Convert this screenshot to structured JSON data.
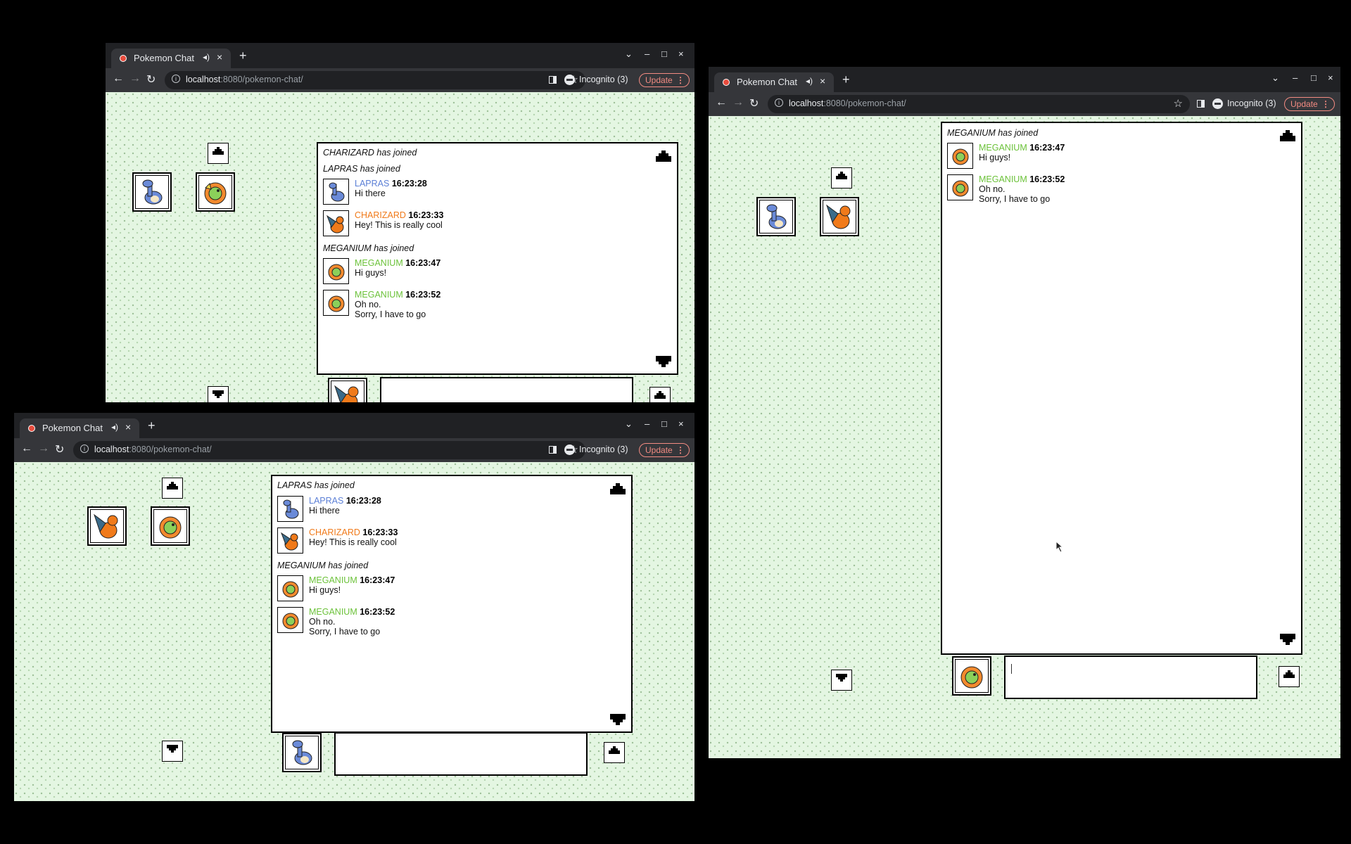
{
  "browser": {
    "tab_title": "Pokemon Chat",
    "url_host": "localhost",
    "url_rest": ":8080/pokemon-chat/",
    "incognito_label": "Incognito (3)",
    "update_label": "Update"
  },
  "colors": {
    "laprasName": "#5b7fd6",
    "charizardName": "#f07a1a",
    "meganiumName": "#6cc23a"
  },
  "icons": {
    "scroll_up": "up-arrow-icon",
    "scroll_down": "down-arrow-icon"
  },
  "win1": {
    "log": [
      {
        "joined": "CHARIZARD has joined"
      },
      {
        "joined": "LAPRAS has joined"
      },
      {
        "name": "LAPRAS",
        "time": "16:23:28",
        "lines": [
          "Hi there"
        ]
      },
      {
        "name": "CHARIZARD",
        "time": "16:23:33",
        "lines": [
          "Hey! This is really cool"
        ]
      },
      {
        "joined": "MEGANIUM has joined"
      },
      {
        "name": "MEGANIUM",
        "time": "16:23:47",
        "lines": [
          "Hi guys!"
        ]
      },
      {
        "name": "MEGANIUM",
        "time": "16:23:52",
        "lines": [
          "Oh no.",
          "Sorry, I have to go"
        ]
      }
    ]
  },
  "win2": {
    "log": [
      {
        "joined": "LAPRAS has joined"
      },
      {
        "name": "LAPRAS",
        "time": "16:23:28",
        "lines": [
          "Hi there"
        ]
      },
      {
        "name": "CHARIZARD",
        "time": "16:23:33",
        "lines": [
          "Hey! This is really cool"
        ]
      },
      {
        "joined": "MEGANIUM has joined"
      },
      {
        "name": "MEGANIUM",
        "time": "16:23:47",
        "lines": [
          "Hi guys!"
        ]
      },
      {
        "name": "MEGANIUM",
        "time": "16:23:52",
        "lines": [
          "Oh no.",
          "Sorry, I have to go"
        ]
      }
    ]
  },
  "win3": {
    "log": [
      {
        "joined": "MEGANIUM has joined"
      },
      {
        "name": "MEGANIUM",
        "time": "16:23:47",
        "lines": [
          "Hi guys!"
        ]
      },
      {
        "name": "MEGANIUM",
        "time": "16:23:52",
        "lines": [
          "Oh no.",
          "Sorry, I have to go"
        ]
      }
    ]
  }
}
